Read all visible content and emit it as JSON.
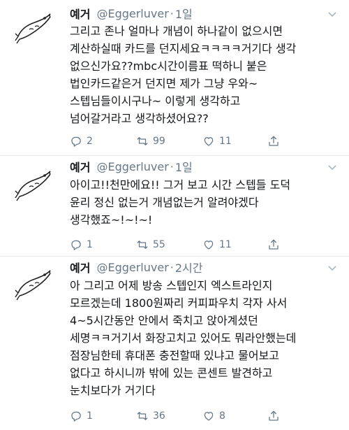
{
  "tweets": [
    {
      "display_name": "예거",
      "handle": "@Eggerluver",
      "separator": "·",
      "time": "1일",
      "lines": [
        "그리고 존나 얼마나 개념이 하나같이 없으시면",
        "계산하실때 카드를 던지세요ㅋㅋㅋㅋ거기다 생각",
        "없으신가요??mbc시간이름표 떡하니 붙은",
        "법인카드같은거 던지면 제가 그냥 우와~",
        "스텝님들이시구나~ 이렇게 생각하고",
        "넘어갈거라고 생각하셨어요??"
      ],
      "replies": "2",
      "retweets": "99",
      "likes": "11"
    },
    {
      "display_name": "예거",
      "handle": "@Eggerluver",
      "separator": "·",
      "time": "1일",
      "lines": [
        "아이고!!천만에요!! 그거 보고 시간 스텝들 도덕",
        "윤리 정신 없는거 개념없는거 알려야겠다",
        "생각했죠~!~!~!"
      ],
      "replies": "1",
      "retweets": "55",
      "likes": "11"
    },
    {
      "display_name": "예거",
      "handle": "@Eggerluver",
      "separator": "·",
      "time": "2시간",
      "lines": [
        "아 그리고 어제 방송 스텝인지 엑스트라인지",
        "모르겠는데 1800원짜리 커피파우치 각자 사서",
        "4~5시간동안 안에서 죽치고 앉아계셨던",
        "세명ㅋㅋ거기서 화장고치고 있어도 뭐라안했는데",
        "점장님한테 휴대폰 충전할때 있냐고 물어보고",
        "없다고 하시니까 밖에 있는 콘센트 발견하고",
        "눈치보다가 거기다"
      ],
      "replies": "1",
      "retweets": "36",
      "likes": "8"
    }
  ],
  "icons": {
    "avatar": "cartoon-fish-drawing",
    "caret": "chevron-down-icon",
    "reply": "reply-icon",
    "retweet": "retweet-icon",
    "like": "heart-icon",
    "share": "share-icon"
  },
  "colors": {
    "text": "#14171a",
    "secondary": "#657786",
    "divider": "#e6ecf0",
    "icon": "#657786"
  }
}
